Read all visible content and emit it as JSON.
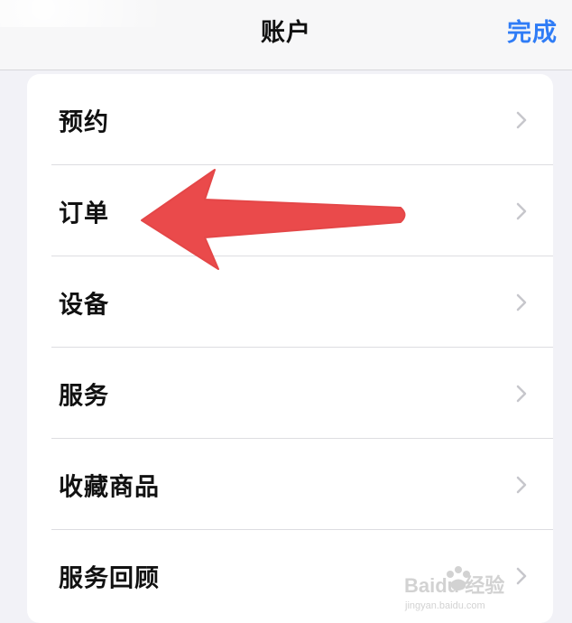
{
  "header": {
    "title": "账户",
    "done_label": "完成"
  },
  "list": {
    "items": [
      {
        "label": "预约"
      },
      {
        "label": "订单"
      },
      {
        "label": "设备"
      },
      {
        "label": "服务"
      },
      {
        "label": "收藏商品"
      },
      {
        "label": "服务回顾"
      }
    ]
  },
  "colors": {
    "accent": "#2f7cf6",
    "arrow": "#ea4a4b",
    "background": "#f2f2f7",
    "card": "#ffffff",
    "separator": "#dddde1"
  },
  "icons": {
    "chevron": "chevron-right-icon",
    "annotation": "red-arrow-icon",
    "watermark": "baidu-jingyan-logo"
  },
  "watermark": {
    "text": "Baidu 经验",
    "subtext": "jingyan.baidu.com"
  }
}
